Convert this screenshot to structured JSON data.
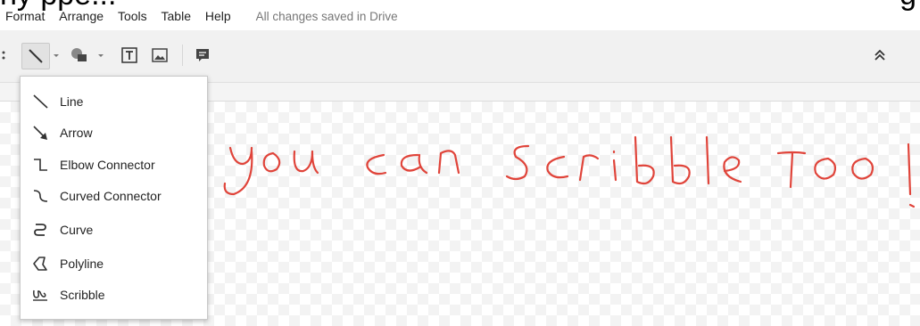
{
  "cut_heading": {
    "left": "ny ppe...",
    "right": "g"
  },
  "menubar": {
    "items": [
      {
        "label": "Format"
      },
      {
        "label": "Arrange"
      },
      {
        "label": "Tools"
      },
      {
        "label": "Table"
      },
      {
        "label": "Help"
      }
    ],
    "status": "All changes saved in Drive"
  },
  "toolbar": {
    "tools": [
      "line-tool",
      "dropdown-arrow",
      "shape-tool",
      "dropdown-arrow",
      "text-box",
      "image",
      "comment"
    ],
    "collapse_icon": "double-chevron-up-icon"
  },
  "line_menu": {
    "items": [
      {
        "label": "Line",
        "icon": "line-icon"
      },
      {
        "label": "Arrow",
        "icon": "arrow-icon"
      },
      {
        "label": "Elbow Connector",
        "icon": "elbow-connector-icon"
      },
      {
        "label": "Curved Connector",
        "icon": "curved-connector-icon"
      },
      {
        "label": "Curve",
        "icon": "curve-icon"
      },
      {
        "label": "Polyline",
        "icon": "polyline-icon"
      },
      {
        "label": "Scribble",
        "icon": "scribble-icon"
      }
    ]
  },
  "canvas": {
    "scribble_text": "you can scribble too!",
    "scribble_color": "#e0443a"
  }
}
